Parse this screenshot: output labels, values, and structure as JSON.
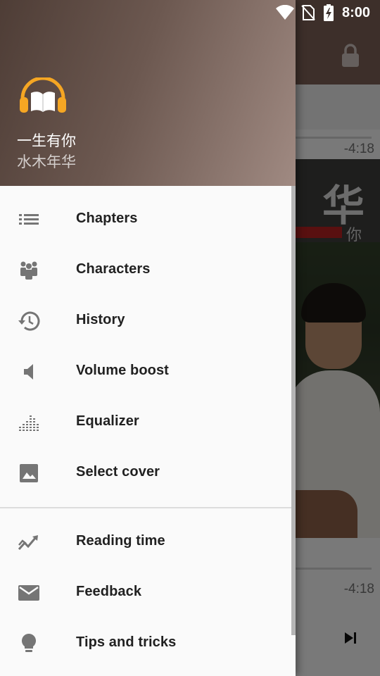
{
  "status_bar": {
    "time": "8:00",
    "icons": [
      "wifi-icon",
      "no-sim-icon",
      "battery-charging-icon"
    ]
  },
  "drawer": {
    "header": {
      "logo_icon": "headphones-book-icon",
      "book_title": "一生有你",
      "book_author": "水木年华"
    },
    "menu_primary": [
      {
        "label": "Chapters",
        "icon": "list-icon"
      },
      {
        "label": "Characters",
        "icon": "people-icon"
      },
      {
        "label": "History",
        "icon": "history-icon"
      },
      {
        "label": "Volume boost",
        "icon": "volume-icon"
      },
      {
        "label": "Equalizer",
        "icon": "equalizer-icon"
      },
      {
        "label": "Select cover",
        "icon": "image-icon"
      }
    ],
    "menu_secondary": [
      {
        "label": "Reading time",
        "icon": "trending-icon"
      },
      {
        "label": "Feedback",
        "icon": "mail-icon"
      },
      {
        "label": "Tips and tricks",
        "icon": "lightbulb-icon"
      }
    ]
  },
  "background_player": {
    "time_remaining_top": "-4:18",
    "time_remaining_bottom": "-4:18",
    "cover_text_large": "华",
    "cover_text_small": "你",
    "icons": [
      "lock-icon",
      "skip-next-icon"
    ]
  },
  "colors": {
    "drawer_header_dark": "#4e3d36",
    "drawer_header_light": "#a08a82",
    "menu_icon_color": "#757575",
    "logo_orange": "#f5a623"
  }
}
